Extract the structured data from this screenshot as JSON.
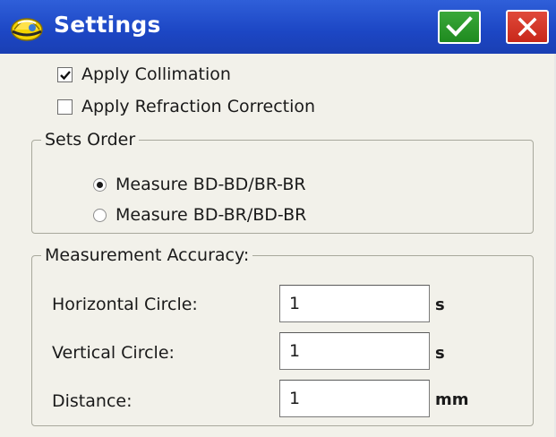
{
  "window": {
    "title": "Settings",
    "icons": {
      "app": "hardhat-icon",
      "ok": "checkmark-icon",
      "close": "close-icon"
    },
    "colors": {
      "titlebar": "#1c46c4",
      "ok": "#1f8a1f",
      "close": "#c8281a"
    }
  },
  "options": {
    "apply_collimation": {
      "label": "Apply Collimation",
      "checked": true
    },
    "apply_refraction": {
      "label": "Apply Refraction Correction",
      "checked": false
    }
  },
  "sets_order": {
    "legend": "Sets Order",
    "options": [
      {
        "label": "Measure BD-BD/BR-BR",
        "selected": true
      },
      {
        "label": "Measure BD-BR/BD-BR",
        "selected": false
      }
    ]
  },
  "accuracy": {
    "legend": "Measurement Accuracy:",
    "fields": [
      {
        "label": "Horizontal Circle:",
        "value": "1",
        "unit": "s"
      },
      {
        "label": "Vertical Circle:",
        "value": "1",
        "unit": "s"
      },
      {
        "label": "Distance:",
        "value": "1",
        "unit": "mm"
      }
    ]
  }
}
